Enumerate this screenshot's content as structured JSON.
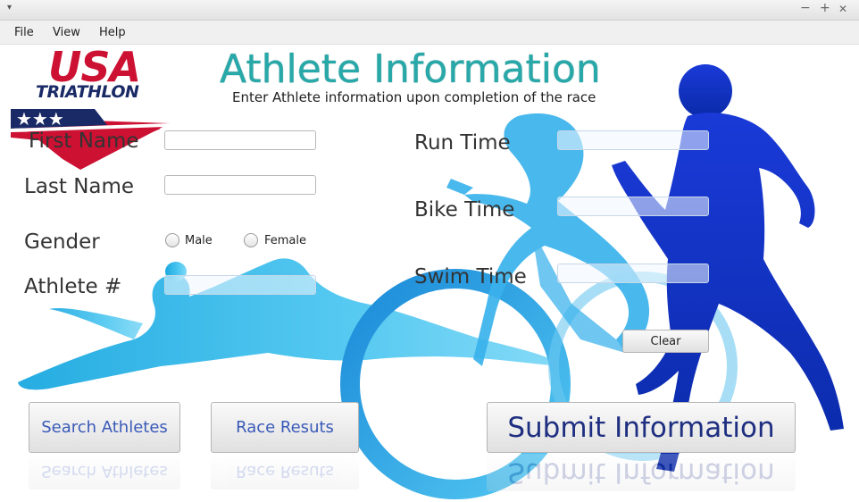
{
  "window": {
    "menu_arrow": "▾",
    "minimize": "−",
    "maximize": "+",
    "close": "✕"
  },
  "menubar": {
    "items": [
      "File",
      "View",
      "Help"
    ]
  },
  "logo": {
    "line1": "USA",
    "line2": "TRIATHLON"
  },
  "header": {
    "title": "Athlete Information",
    "subtitle": "Enter Athlete information upon completion of the race"
  },
  "form": {
    "first_name_label": "First Name",
    "last_name_label": "Last Name",
    "gender_label": "Gender",
    "gender_options": [
      "Male",
      "Female"
    ],
    "athlete_number_label": "Athlete #",
    "run_time_label": "Run Time",
    "bike_time_label": "Bike Time",
    "swim_time_label": "Swim Time",
    "first_name_value": "",
    "last_name_value": "",
    "athlete_number_value": "",
    "run_time_value": "",
    "bike_time_value": "",
    "swim_time_value": ""
  },
  "buttons": {
    "clear": "Clear",
    "search_athletes": "Search Athletes",
    "race_results": "Race Resuts",
    "submit": "Submit Information"
  },
  "colors": {
    "title": "#28a8a8",
    "logo_red": "#cc1133",
    "logo_navy": "#1a2a66",
    "swimmer": "#29b6e8",
    "runner": "#1030c0",
    "button_text": "#3a5ab8"
  }
}
